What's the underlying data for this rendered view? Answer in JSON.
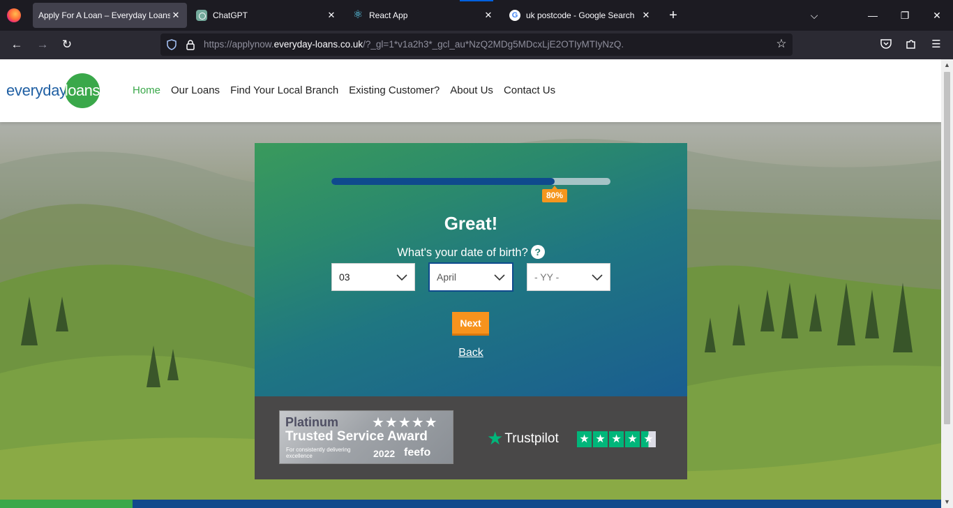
{
  "browser": {
    "tabs": [
      {
        "title": "Apply For A Loan – Everyday Loans",
        "active": true,
        "favicon": "everyday-loans-favicon"
      },
      {
        "title": "ChatGPT",
        "active": false,
        "favicon": "chatgpt-favicon"
      },
      {
        "title": "React App",
        "active": false,
        "favicon": "react-favicon"
      },
      {
        "title": "uk postcode - Google Search",
        "active": false,
        "favicon": "google-favicon"
      }
    ],
    "url_prefix": "https://applynow.",
    "url_domain": "everyday-loans.co.uk",
    "url_rest": "/?_gl=1*v1a2h3*_gcl_au*NzQ2MDg5MDcxLjE2OTIyMTIyNzQ."
  },
  "site": {
    "logo_word1": "everyday",
    "logo_word2": "loans",
    "nav": [
      "Home",
      "Our Loans",
      "Find Your Local Branch",
      "Existing Customer?",
      "About Us",
      "Contact Us"
    ],
    "active_nav": "Home"
  },
  "form": {
    "progress_percent": 80,
    "progress_label": "80%",
    "title": "Great!",
    "question": "What's your date of birth?",
    "help_glyph": "?",
    "day_value": "03",
    "month_value": "April",
    "year_placeholder": "- YY -",
    "next_label": "Next",
    "back_label": "Back"
  },
  "trust": {
    "feefo": {
      "tier": "Platinum",
      "award": "Trusted Service Award",
      "subtitle": "For consistently delivering excellence",
      "year": "2022",
      "brand": "feefo"
    },
    "trustpilot": {
      "name": "Trustpilot",
      "rating_stars": 4.5
    }
  },
  "colors": {
    "brand_green": "#3aa84a",
    "brand_blue": "#0f4a8d",
    "cta_orange": "#f7931d",
    "trustpilot_green": "#00b67a"
  }
}
